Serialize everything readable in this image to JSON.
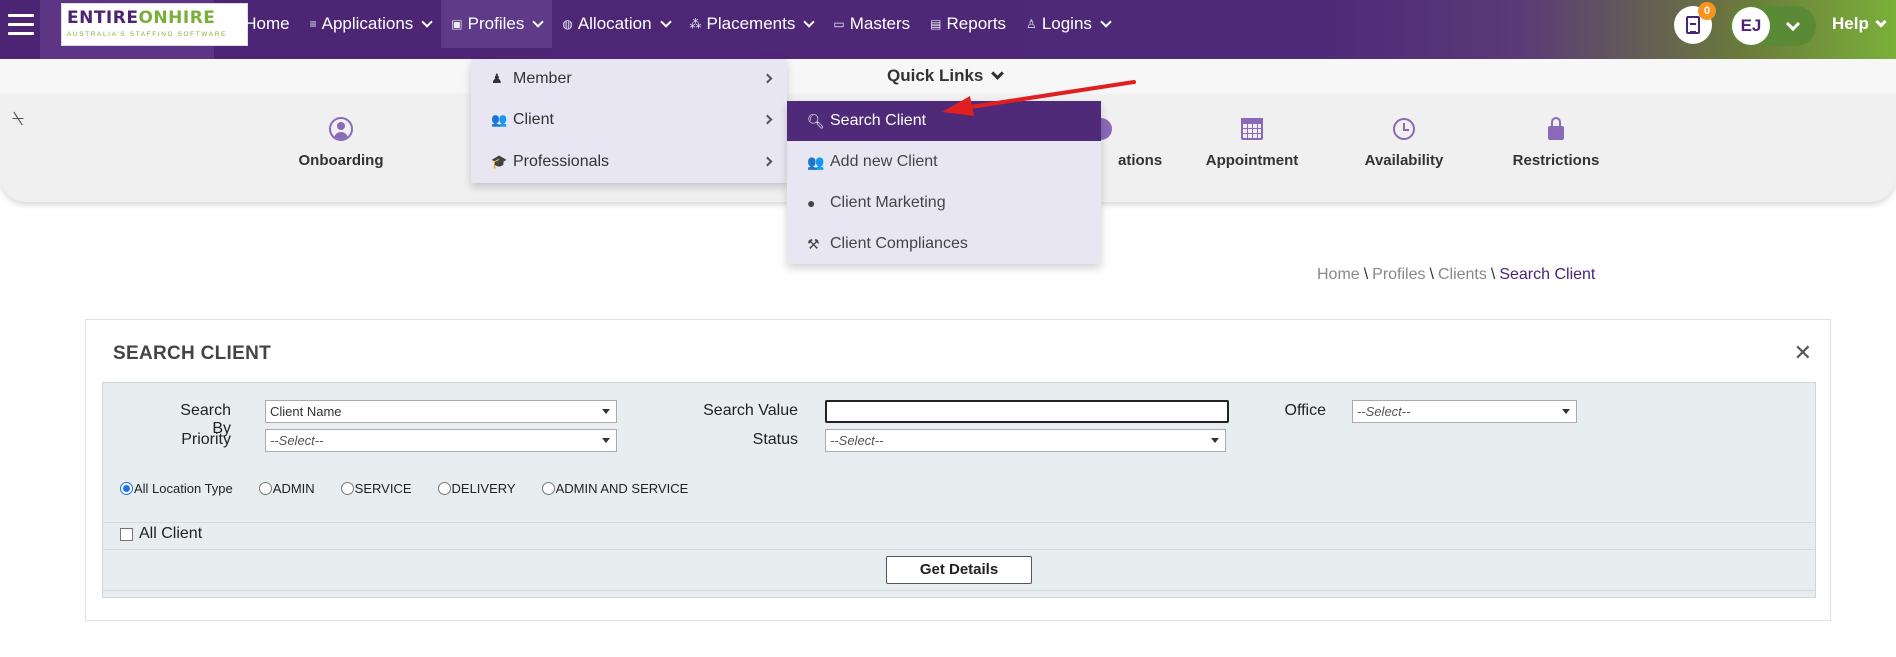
{
  "header": {
    "logo_main_a": "ENTIRE",
    "logo_main_b": "ONHIRE",
    "logo_tagline": "AUSTRALIA'S STAFFING SOFTWARE",
    "nav": [
      {
        "label": "Home",
        "icon": "home-icon"
      },
      {
        "label": "Applications",
        "icon": "list-icon"
      },
      {
        "label": "Profiles",
        "icon": "profile-icon"
      },
      {
        "label": "Allocation",
        "icon": "globe-icon"
      },
      {
        "label": "Placements",
        "icon": "network-icon"
      },
      {
        "label": "Masters",
        "icon": "folder-icon"
      },
      {
        "label": "Reports",
        "icon": "report-icon"
      },
      {
        "label": "Logins",
        "icon": "user-icon"
      }
    ],
    "notification_count": "0",
    "user_initials": "EJ",
    "help_label": "Help"
  },
  "quick_links": {
    "label": "Quick Links",
    "items": [
      {
        "label": "Onboarding",
        "icon": "person-circle-icon"
      },
      {
        "label": "ations",
        "icon": "pie-icon"
      },
      {
        "label": "Appointment",
        "icon": "calendar-icon"
      },
      {
        "label": "Availability",
        "icon": "clock-icon"
      },
      {
        "label": "Restrictions",
        "icon": "lock-icon"
      }
    ]
  },
  "profiles_menu": {
    "items": [
      {
        "label": "Member",
        "icon": "member-icon"
      },
      {
        "label": "Client",
        "icon": "users-icon"
      },
      {
        "label": "Professionals",
        "icon": "graduation-cap-icon"
      }
    ]
  },
  "client_submenu": {
    "items": [
      {
        "label": "Search Client",
        "icon": "search-icon",
        "selected": true
      },
      {
        "label": "Add new Client",
        "icon": "users-icon"
      },
      {
        "label": "Client Marketing",
        "icon": "globe-icon"
      },
      {
        "label": "Client Compliances",
        "icon": "gavel-icon"
      }
    ]
  },
  "breadcrumb": {
    "items": [
      "Home",
      "Profiles",
      "Clients",
      "Search Client"
    ],
    "separator": "\\"
  },
  "search_form": {
    "title": "SEARCH CLIENT",
    "search_by_label": "Search By",
    "search_by_value": "Client Name",
    "search_value_label": "Search Value",
    "search_value": "",
    "office_label": "Office",
    "office_value": "--Select--",
    "priority_label": "Priority",
    "priority_value": "--Select--",
    "status_label": "Status",
    "status_value": "--Select--",
    "location_types": [
      {
        "label": "All Location Type",
        "checked": true
      },
      {
        "label": "ADMIN",
        "checked": false
      },
      {
        "label": "SERVICE",
        "checked": false
      },
      {
        "label": "DELIVERY",
        "checked": false
      },
      {
        "label": "ADMIN AND SERVICE",
        "checked": false
      }
    ],
    "all_client_label": "All Client",
    "submit_label": "Get Details"
  },
  "colors": {
    "brand_purple": "#4b2474",
    "brand_green": "#7ab03a",
    "menu_bg": "#e9e6f3",
    "selected_menu": "#4f2a78",
    "badge_orange": "#f7941d",
    "annotation_red": "#e02020"
  }
}
